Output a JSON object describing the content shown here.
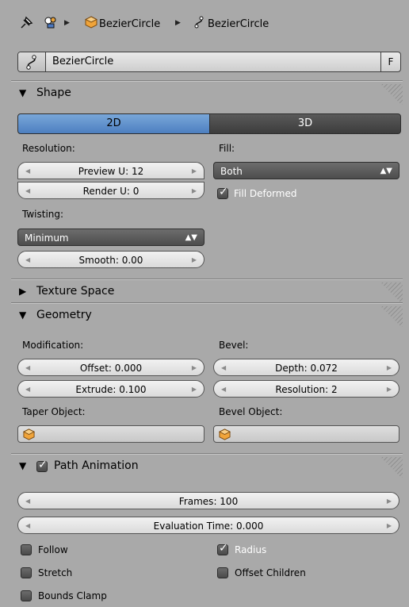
{
  "breadcrumb": {
    "object": "BezierCircle",
    "data": "BezierCircle"
  },
  "datablock": {
    "name": "BezierCircle",
    "fake_user": "F"
  },
  "shape": {
    "title": "Shape",
    "dim_2d": "2D",
    "dim_3d": "3D",
    "active_dim": "2D",
    "resolution_label": "Resolution:",
    "preview_u": "Preview U: 12",
    "render_u": "Render U: 0",
    "fill_label": "Fill:",
    "fill_value": "Both",
    "fill_deformed": "Fill Deformed",
    "fill_deformed_checked": true,
    "twisting_label": "Twisting:",
    "twisting_value": "Minimum",
    "smooth": "Smooth: 0.00"
  },
  "texture_space": {
    "title": "Texture Space"
  },
  "geometry": {
    "title": "Geometry",
    "modification_label": "Modification:",
    "offset": "Offset: 0.000",
    "extrude": "Extrude: 0.100",
    "bevel_label": "Bevel:",
    "depth": "Depth: 0.072",
    "resolution": "Resolution: 2",
    "taper_label": "Taper Object:",
    "bevel_object_label": "Bevel Object:"
  },
  "path_animation": {
    "title": "Path Animation",
    "enabled": true,
    "frames": "Frames: 100",
    "eval_time": "Evaluation Time: 0.000",
    "follow": "Follow",
    "radius": "Radius",
    "stretch": "Stretch",
    "offset_children": "Offset Children",
    "bounds_clamp": "Bounds Clamp",
    "follow_checked": false,
    "radius_checked": true,
    "stretch_checked": false,
    "offset_children_checked": false,
    "bounds_clamp_checked": false
  },
  "colors": {
    "panel_bg": "#a9a9a9",
    "accent": "#5a8ed0",
    "header_bg": "#a9a9a9"
  }
}
